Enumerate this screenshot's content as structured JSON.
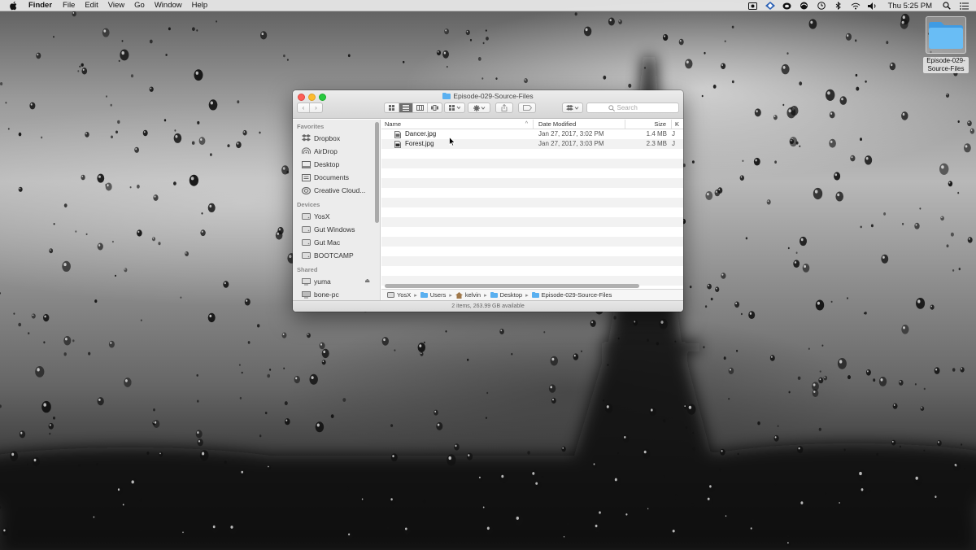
{
  "menubar": {
    "app_name": "Finder",
    "items": [
      "File",
      "Edit",
      "View",
      "Go",
      "Window",
      "Help"
    ],
    "clock": "Thu 5:25 PM",
    "status_icons": [
      "screen-record-icon",
      "dropbox-status-icon",
      "creative-cloud-status-icon",
      "time-machine-icon",
      "clock-status-icon",
      "bluetooth-icon",
      "wifi-icon",
      "volume-icon",
      "spotlight-icon",
      "notification-center-icon"
    ]
  },
  "desktop": {
    "folder_label": "Episode-029-Source-Files"
  },
  "window": {
    "title": "Episode-029-Source-Files",
    "toolbar": {
      "back_glyph": "‹",
      "forward_glyph": "›",
      "search_placeholder": "Search"
    },
    "sidebar": {
      "sections": [
        {
          "heading": "Favorites",
          "items": [
            {
              "label": "Dropbox",
              "icon": "dropbox-icon"
            },
            {
              "label": "AirDrop",
              "icon": "airdrop-icon"
            },
            {
              "label": "Desktop",
              "icon": "desktop-icon"
            },
            {
              "label": "Documents",
              "icon": "documents-icon"
            },
            {
              "label": "Creative Cloud...",
              "icon": "creative-cloud-icon"
            }
          ]
        },
        {
          "heading": "Devices",
          "items": [
            {
              "label": "YosX",
              "icon": "drive-icon"
            },
            {
              "label": "Gut Windows",
              "icon": "drive-icon"
            },
            {
              "label": "Gut Mac",
              "icon": "drive-icon"
            },
            {
              "label": "BOOTCAMP",
              "icon": "drive-icon"
            }
          ]
        },
        {
          "heading": "Shared",
          "items": [
            {
              "label": "yuma",
              "icon": "computer-icon",
              "eject": "⏏"
            },
            {
              "label": "bone-pc",
              "icon": "pc-icon"
            }
          ]
        }
      ]
    },
    "columns": {
      "name": "Name",
      "date": "Date Modified",
      "size": "Size",
      "kind": "K"
    },
    "files": [
      {
        "name": "Dancer.jpg",
        "date": "Jan 27, 2017, 3:02 PM",
        "size": "1.4 MB",
        "kind": "J"
      },
      {
        "name": "Forest.jpg",
        "date": "Jan 27, 2017, 3:03 PM",
        "size": "2.3 MB",
        "kind": "J"
      }
    ],
    "path": [
      "YosX",
      "Users",
      "kelvin",
      "Desktop",
      "Episode-029-Source-Files"
    ],
    "status": "2 items, 263.99 GB available"
  },
  "colors": {
    "close": "#fc5f57",
    "minimize": "#fdbb2e",
    "zoom": "#28c93f",
    "folder_blue": "#5ab0f0"
  }
}
